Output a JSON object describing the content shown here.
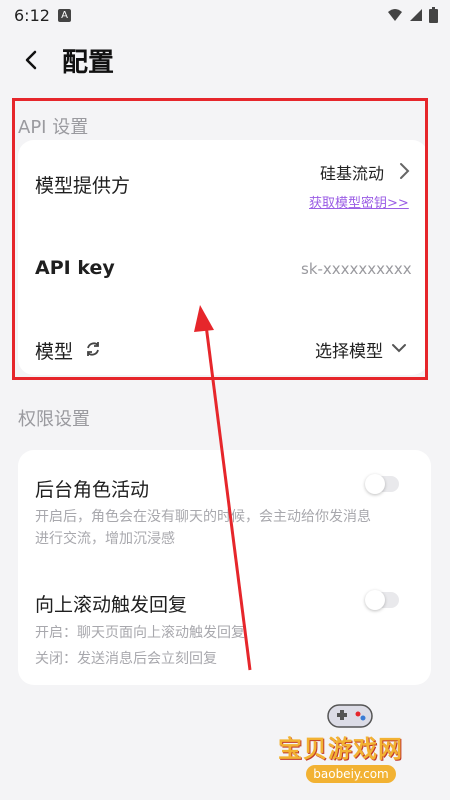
{
  "status": {
    "time": "6:12",
    "notif_letter": "A"
  },
  "header": {
    "title": "配置"
  },
  "api_section": {
    "title": "API 设置",
    "provider": {
      "label": "模型提供方",
      "value": "硅基流动",
      "link": "获取模型密钥>>"
    },
    "api_key": {
      "label": "API key",
      "value": "sk-xxxxxxxxxx"
    },
    "model": {
      "label": "模型",
      "value": "选择模型"
    }
  },
  "perm_section": {
    "title": "权限设置",
    "background": {
      "label": "后台角色活动",
      "desc_line1": "开启后，角色会在没有聊天的时候，会主动给你发消息",
      "desc_line2": "进行交流，增加沉浸感",
      "enabled": false
    },
    "scroll": {
      "label": "向上滚动触发回复",
      "desc_line1": "开启：聊天页面向上滚动触发回复",
      "desc_line2": "关闭：发送消息后会立刻回复",
      "enabled": false
    }
  },
  "watermark": {
    "text": "宝贝游戏网",
    "url": "baobeiy.com"
  },
  "colors": {
    "accent": "#9b5de5",
    "highlight": "#e6262b"
  }
}
